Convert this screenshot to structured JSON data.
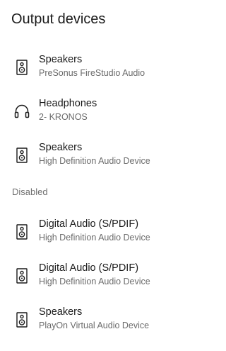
{
  "title": "Output devices",
  "devices_active": [
    {
      "name": "Speakers",
      "detail": "PreSonus FireStudio Audio",
      "icon": "speaker-icon"
    },
    {
      "name": "Headphones",
      "detail": "2- KRONOS",
      "icon": "headphones-icon"
    },
    {
      "name": "Speakers",
      "detail": "High Definition Audio Device",
      "icon": "speaker-icon"
    }
  ],
  "disabled_header": "Disabled",
  "devices_disabled": [
    {
      "name": "Digital Audio (S/PDIF)",
      "detail": "High Definition Audio Device",
      "icon": "speaker-icon"
    },
    {
      "name": "Digital Audio (S/PDIF)",
      "detail": "High Definition Audio Device",
      "icon": "speaker-icon"
    },
    {
      "name": "Speakers",
      "detail": "PlayOn Virtual Audio Device",
      "icon": "speaker-icon"
    }
  ]
}
